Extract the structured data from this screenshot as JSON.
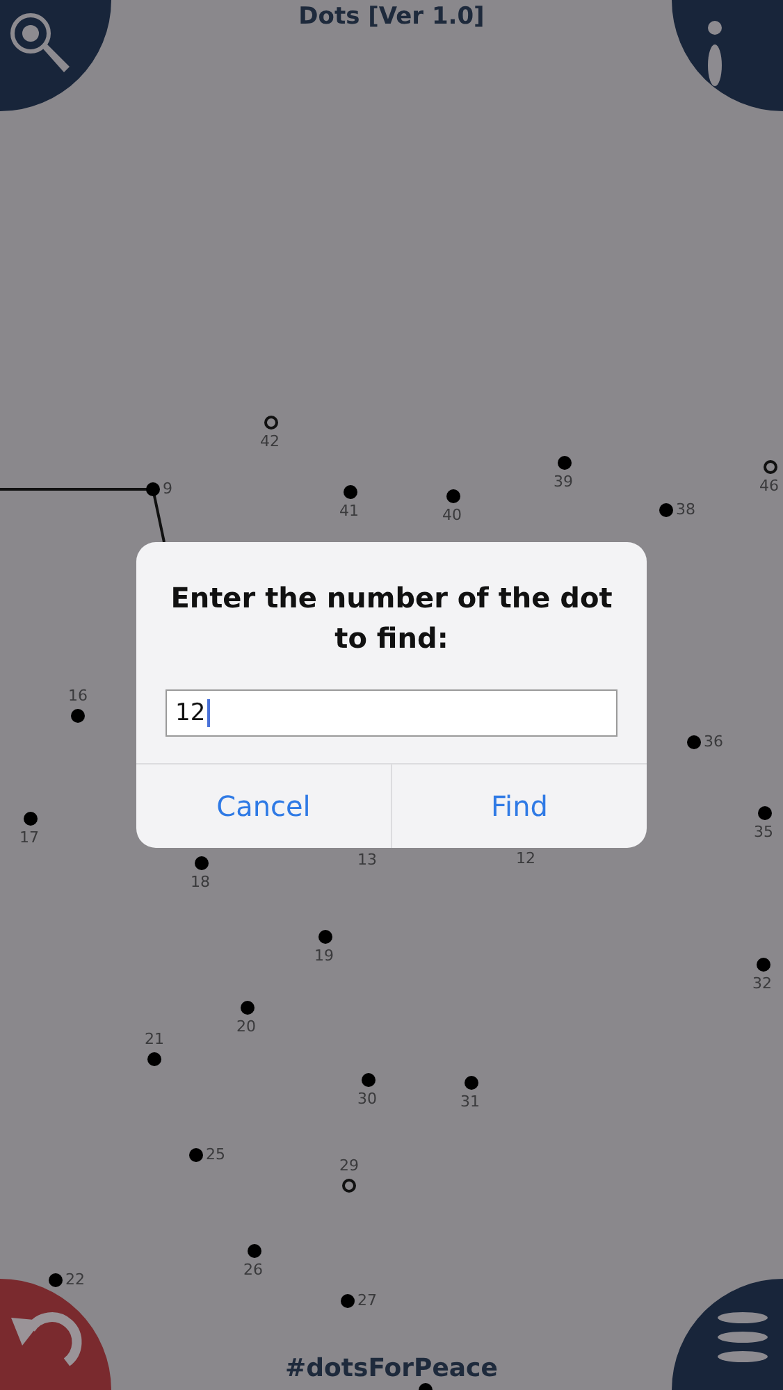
{
  "title": "Dots [Ver 1.0]",
  "dots": [
    {
      "label": "42",
      "filled": false
    },
    {
      "label": "9",
      "filled": true
    },
    {
      "label": "41",
      "filled": true
    },
    {
      "label": "40",
      "filled": true
    },
    {
      "label": "39",
      "filled": true
    },
    {
      "label": "46",
      "filled": false
    },
    {
      "label": "38",
      "filled": true
    },
    {
      "label": "16",
      "filled": true
    },
    {
      "label": "36",
      "filled": true
    },
    {
      "label": "17",
      "filled": true
    },
    {
      "label": "35",
      "filled": true
    },
    {
      "label": "18",
      "filled": true
    },
    {
      "label": "13"
    },
    {
      "label": "12"
    },
    {
      "label": "19",
      "filled": true
    },
    {
      "label": "32",
      "filled": true
    },
    {
      "label": "20",
      "filled": true
    },
    {
      "label": "21",
      "filled": true
    },
    {
      "label": "30",
      "filled": true
    },
    {
      "label": "31",
      "filled": true
    },
    {
      "label": "25",
      "filled": true
    },
    {
      "label": "29",
      "filled": false
    },
    {
      "label": "26",
      "filled": true
    },
    {
      "label": "22",
      "filled": true
    },
    {
      "label": "27",
      "filled": true
    }
  ],
  "footer": "#dotsForPeace",
  "dialog": {
    "title": "Enter the number of the dot to find:",
    "value": "12",
    "buttons": [
      "Cancel",
      "Find"
    ]
  }
}
